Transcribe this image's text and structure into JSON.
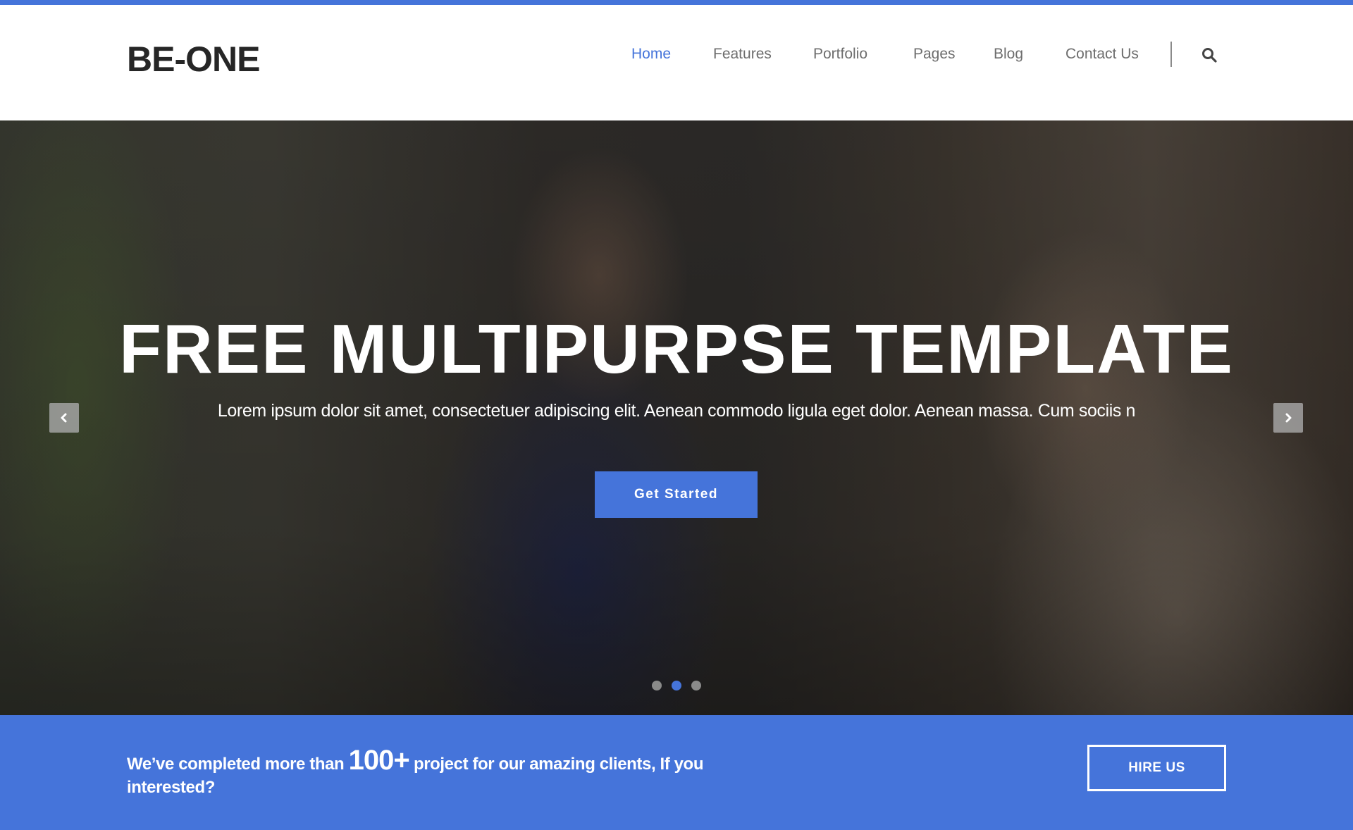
{
  "colors": {
    "accent": "#4574da",
    "logo": "#262626",
    "nav_text": "#6d6d6d"
  },
  "header": {
    "logo": "BE-ONE",
    "nav": [
      {
        "label": "Home",
        "active": true
      },
      {
        "label": "Features",
        "active": false
      },
      {
        "label": "Portfolio",
        "active": false
      },
      {
        "label": "Pages",
        "active": false
      },
      {
        "label": "Blog",
        "active": false
      },
      {
        "label": "Contact Us",
        "active": false
      }
    ],
    "search_icon": "search-icon"
  },
  "hero": {
    "title": "FREE MULTIPURPSE TEMPLATE",
    "subtitle": "Lorem ipsum dolor sit amet, consectetuer adipiscing elit. Aenean commodo ligula eget dolor. Aenean massa. Cum sociis n",
    "cta_label": "Get Started",
    "prev_icon": "chevron-left-icon",
    "next_icon": "chevron-right-icon",
    "slides_total": 3,
    "active_slide": 2
  },
  "banner": {
    "text_before": "We’ve completed more than ",
    "highlight": "100+",
    "text_after": " project for our amazing clients, If you interested?",
    "button_label": "HIRE US"
  }
}
